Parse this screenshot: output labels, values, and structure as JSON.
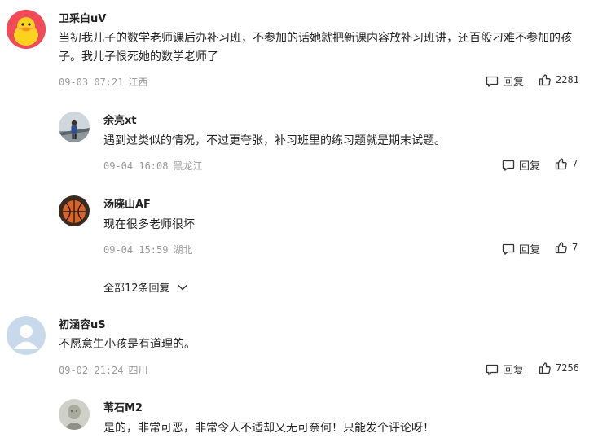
{
  "comments": [
    {
      "author": "卫采白uV",
      "text": "当初我儿子的数学老师课后办补习班，不参加的话她就把新课内容放补习班讲，还百般刁难不参加的孩子。我儿子恨死她的数学老师了",
      "date": "09-03 07:21",
      "location": "江西",
      "reply_label": "回复",
      "likes": "2281",
      "avatar_icon": "duck-avatar"
    },
    {
      "author": "余亮xt",
      "text": "遇到过类似的情况，不过更夸张，补习班里的练习题就是期末试题。",
      "date": "09-04 16:08",
      "location": "黑龙江",
      "reply_label": "回复",
      "likes": "7",
      "avatar_icon": "person-photo-avatar"
    },
    {
      "author": "汤晓山AF",
      "text": "现在很多老师很坏",
      "date": "09-04 15:59",
      "location": "湖北",
      "reply_label": "回复",
      "likes": "7",
      "avatar_icon": "basketball-avatar"
    },
    {
      "author": "初涵容uS",
      "text": "不愿意生小孩是有道理的。",
      "date": "09-02 21:24",
      "location": "四川",
      "reply_label": "回复",
      "likes": "7256",
      "avatar_icon": "default-user-avatar"
    },
    {
      "author": "苇石M2",
      "text": "是的，非常可恶，非常令人不适却又无可奈何！只能发个评论呀！",
      "avatar_icon": "statue-photo-avatar"
    }
  ],
  "replies_toggle": {
    "label": "全部12条回复"
  },
  "colors": {
    "text": "#222222",
    "meta": "#999999",
    "divider": "#e6e6e6"
  }
}
